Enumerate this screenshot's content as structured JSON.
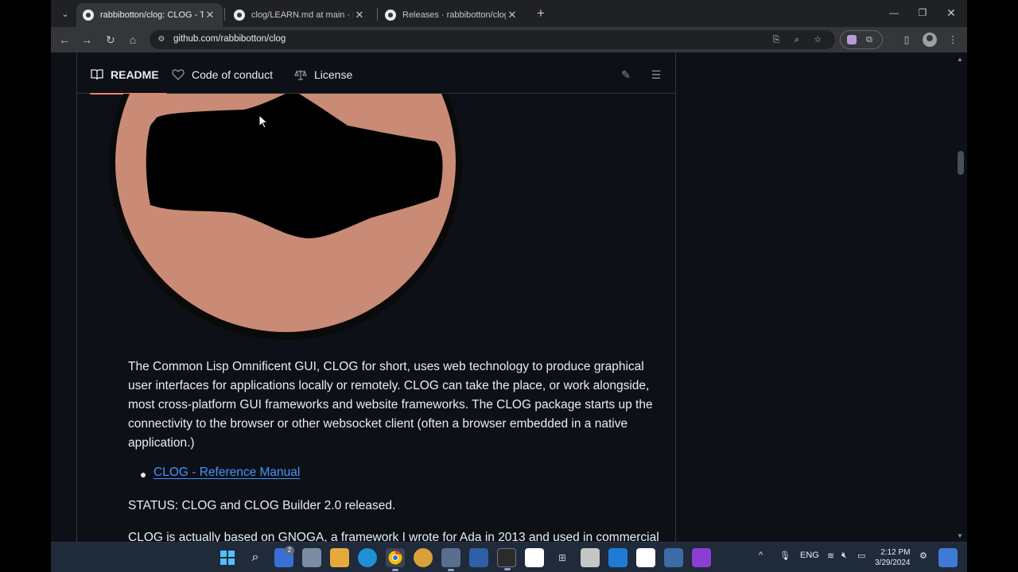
{
  "browser": {
    "tabs": [
      {
        "title": "rabbibotton/clog: CLOG - The C",
        "active": true
      },
      {
        "title": "clog/LEARN.md at main · rabbib",
        "active": false
      },
      {
        "title": "Releases · rabbibotton/clog",
        "active": false
      }
    ],
    "url": "github.com/rabbibotton/clog"
  },
  "readme_nav": {
    "readme": "README",
    "code_of_conduct": "Code of conduct",
    "license": "License"
  },
  "content": {
    "paragraph": "The Common Lisp Omnificent GUI, CLOG for short, uses web technology to produce graphical user interfaces for applications locally or remotely. CLOG can take the place, or work alongside, most cross-platform GUI frameworks and website frameworks. The CLOG package starts up the connectivity to the browser or other websocket client (often a browser embedded in a native application.)",
    "list_items": [
      "CLOG - Reference Manual"
    ],
    "status": "STATUS: CLOG and CLOG Builder 2.0 released.",
    "partial_line": "CLOG is actually based on GNOGA, a framework I wrote for Ada in 2013 and used in commercial"
  },
  "taskbar": {
    "notification_badge": "2",
    "language": "ENG",
    "time": "2:12 PM",
    "date": "3/29/2024"
  },
  "colors": {
    "page_bg": "#0d1117",
    "text": "#e6edf3",
    "link": "#4493f8",
    "tab_underline": "#f78166",
    "logo_skin": "#c98b76"
  }
}
